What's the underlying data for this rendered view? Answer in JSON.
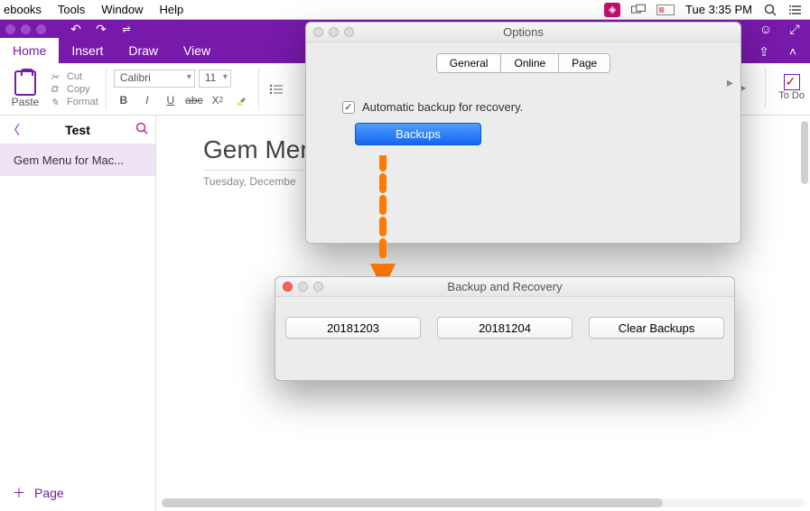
{
  "menubar": {
    "items": [
      "ebooks",
      "Tools",
      "Window",
      "Help"
    ],
    "clock": "Tue 3:35 PM"
  },
  "onenote": {
    "tabs": {
      "home": "Home",
      "insert": "Insert",
      "draw": "Draw",
      "view": "View"
    },
    "ribbon": {
      "paste": "Paste",
      "cut": "Cut",
      "copy": "Copy",
      "format": "Format",
      "font": "Calibri",
      "size": "11",
      "todo": "To Do"
    },
    "sidebar": {
      "title": "Test",
      "page0": "Gem Menu for Mac...",
      "addpage": "Page"
    },
    "doc": {
      "title": "Gem Men",
      "date": "Tuesday, Decembe"
    }
  },
  "options": {
    "title": "Options",
    "tabs": {
      "general": "General",
      "online": "Online",
      "page": "Page"
    },
    "auto_backup": "Automatic backup for recovery.",
    "backups_btn": "Backups"
  },
  "backup": {
    "title": "Backup and Recovery",
    "b1": "20181203",
    "b2": "20181204",
    "clear": "Clear Backups"
  }
}
